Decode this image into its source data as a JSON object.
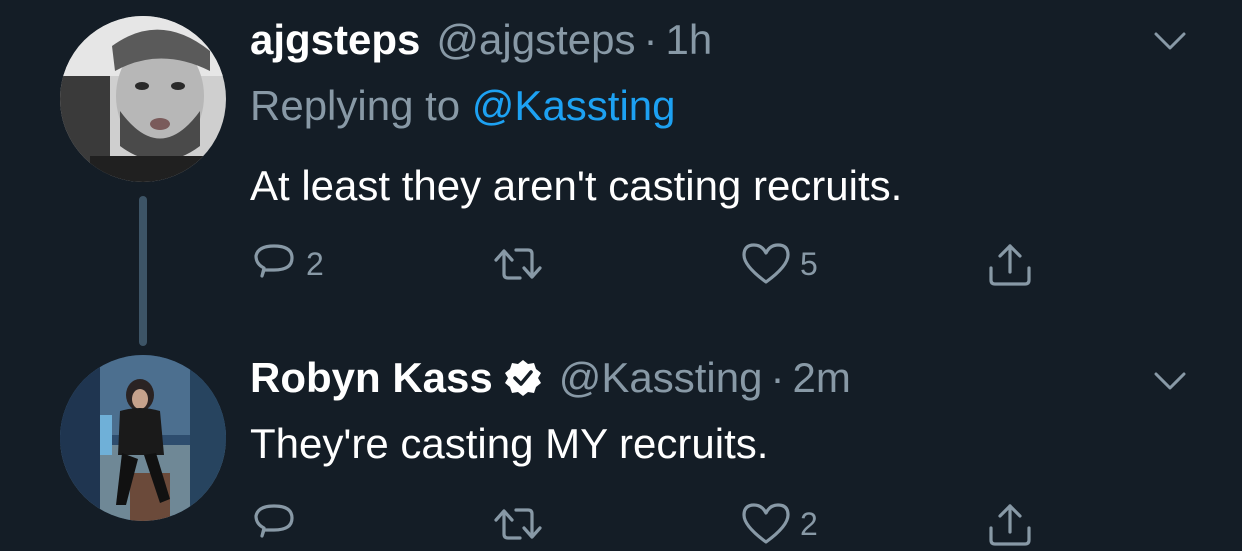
{
  "tweets": [
    {
      "name": "ajgsteps",
      "handle": "@ajgsteps",
      "separator": "·",
      "time": "1h",
      "reply_prefix": "Replying to",
      "reply_mention": "@Kassting",
      "text": "At least they aren't casting recruits.",
      "verified": false,
      "actions": {
        "reply_count": "2",
        "retweet_count": "",
        "like_count": "5"
      }
    },
    {
      "name": "Robyn Kass",
      "handle": "@Kassting",
      "separator": "·",
      "time": "2m",
      "text": "They're casting MY recruits.",
      "verified": true,
      "actions": {
        "reply_count": "",
        "retweet_count": "",
        "like_count": "2"
      }
    }
  ],
  "icons": {
    "reply": "reply-icon",
    "retweet": "retweet-icon",
    "like": "heart-icon",
    "share": "share-icon",
    "menu": "chevron-down-icon",
    "verified": "verified-badge-icon"
  },
  "colors": {
    "background": "#141d26",
    "secondary_text": "#8899a6",
    "link": "#1da1f2",
    "thread_line": "#3d5466"
  }
}
